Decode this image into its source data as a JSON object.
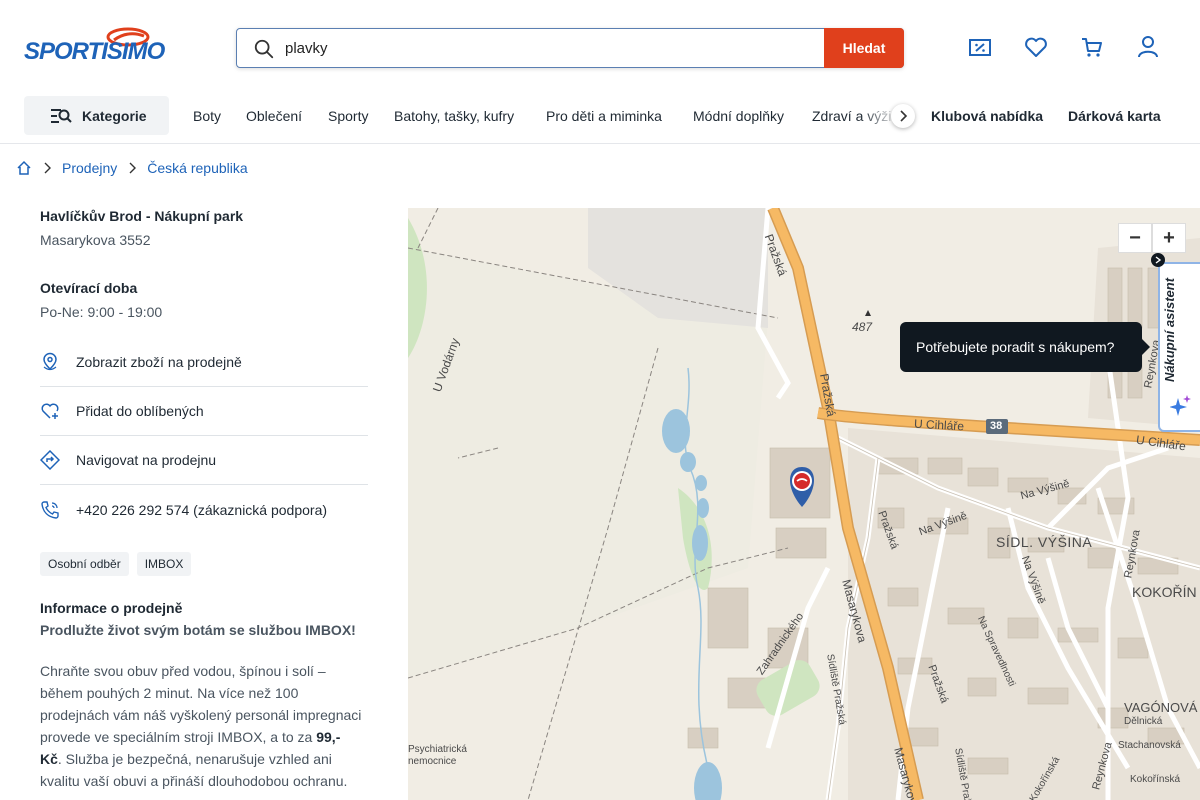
{
  "header": {
    "logo_text": "SPORTISIMO",
    "search": {
      "value": "plavky",
      "button_label": "Hledat"
    },
    "icons": [
      "discount-icon",
      "heart-icon",
      "cart-icon",
      "user-icon"
    ]
  },
  "nav": {
    "kategorie_label": "Kategorie",
    "items": [
      "Boty",
      "Oblečení",
      "Sporty",
      "Batohy, tašky, kufry",
      "Pro děti a miminka",
      "Módní doplňky",
      "Zdraví a výživa"
    ],
    "bold_items": [
      "Klubová nabídka",
      "Dárková karta"
    ]
  },
  "breadcrumb": {
    "items": [
      "Prodejny",
      "Česká republika"
    ]
  },
  "store": {
    "name": "Havlíčkův Brod - Nákupní park",
    "address": "Masarykova 3552",
    "hours_title": "Otevírací doba",
    "hours": "Po-Ne: 9:00 - 19:00",
    "actions": [
      {
        "label": "Zobrazit zboží na prodejně",
        "icon": "map-pin-icon"
      },
      {
        "label": "Přidat do oblíbených",
        "icon": "heart-plus-icon"
      },
      {
        "label": "Navigovat na prodejnu",
        "icon": "navigation-icon"
      },
      {
        "label": "+420 226 292 574 (zákaznická podpora)",
        "icon": "phone-icon"
      }
    ],
    "tags": [
      "Osobní odběr",
      "IMBOX"
    ],
    "info_title": "Informace o prodejně",
    "info_subtitle": "Prodlužte život svým botám se službou IMBOX!",
    "info_text_1": "Chraňte svou obuv před vodou, špínou i solí – během pouhých 2 minut. Na více než 100 prodejnách vám náš vyškolený personál impregnaci provede ve speciálním stroji IMBOX, a to za ",
    "info_price": "99,- Kč",
    "info_text_2": ". Služba je bezpečná, nenarušuje vzhled ani kvalitu vaší obuvi a přináší dlouhodobou ochranu."
  },
  "map": {
    "zoom_out": "−",
    "zoom_in": "+",
    "labels": {
      "prazska1": "Pražská",
      "prazska2": "Pražská",
      "prazska3": "Pražská",
      "prazska4": "Pražská",
      "elevation": "487",
      "u_vodarny": "U Vodárny",
      "u_cihlare1": "U Cihláře",
      "u_cihlare2": "U Cihláře",
      "road_number": "38",
      "na_vysine1": "Na Výšině",
      "na_vysine2": "Na Výšině",
      "na_vysine3": "Na Výšině",
      "sidl_vysina": "SÍDL. VÝŠINA",
      "kokorin": "KOKOŘÍN",
      "reynkova1": "Reynkova",
      "reynkova2": "Reynkova",
      "reynkova3": "Reynkova",
      "masarykova1": "Masarykova",
      "masarykova2": "Masarykova",
      "zahradnickeho": "Zahradnického",
      "sidliste_prazska1": "Sídliště Pražská",
      "sidliste_prazska2": "Sídliště Pražská",
      "na_spravedlnosti": "Na Spravedlnosti",
      "vagonova": "VAGÓNOVÁ",
      "delnicka": "Dělnická",
      "stachanovska": "Stachanovská",
      "kokorinska1": "Kokořínská",
      "kokorinska2": "Kokořínská",
      "psychiatricka": "Psychiatrická",
      "nemocnice": "nemocnice"
    }
  },
  "assistant": {
    "tooltip": "Potřebujete poradit s nákupem?",
    "label": "Nákupní asistent"
  },
  "colors": {
    "brand_blue": "#1e63b8",
    "search_button": "#e0401c",
    "map_marker": "#d52b2b"
  }
}
